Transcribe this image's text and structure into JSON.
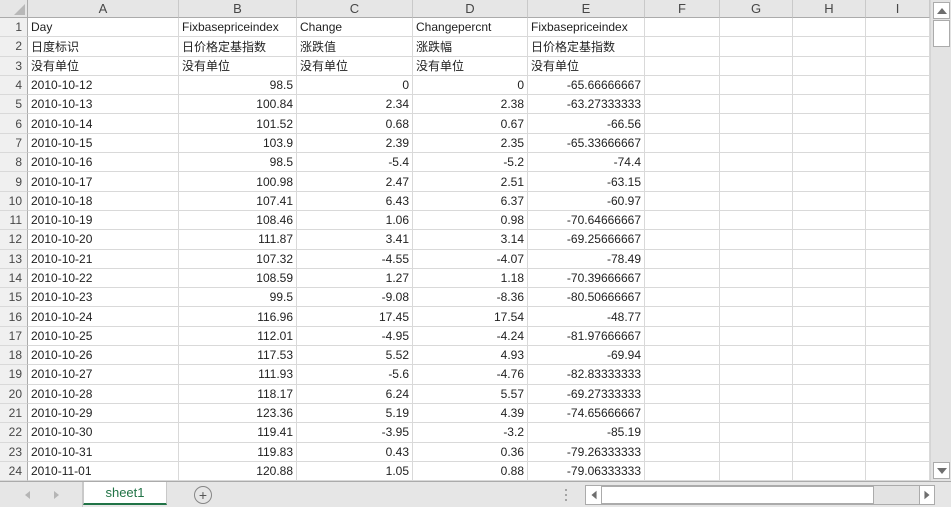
{
  "grid": {
    "column_letters": [
      "A",
      "B",
      "C",
      "D",
      "E",
      "F",
      "G",
      "H",
      "I"
    ],
    "rows": [
      {
        "n": "1",
        "cells": [
          "Day",
          "Fixbasepriceindex",
          "Change",
          "Changepercnt",
          "Fixbasepriceindex",
          "",
          "",
          "",
          ""
        ]
      },
      {
        "n": "2",
        "cells": [
          "日度标识",
          "日价格定基指数",
          "涨跌值",
          "涨跌幅",
          "日价格定基指数",
          "",
          "",
          "",
          ""
        ]
      },
      {
        "n": "3",
        "cells": [
          "没有单位",
          "没有单位",
          "没有单位",
          "没有单位",
          "没有单位",
          "",
          "",
          "",
          ""
        ]
      },
      {
        "n": "4",
        "cells": [
          "2010-10-12",
          "98.5",
          "0",
          "0",
          "-65.66666667",
          "",
          "",
          "",
          ""
        ]
      },
      {
        "n": "5",
        "cells": [
          "2010-10-13",
          "100.84",
          "2.34",
          "2.38",
          "-63.27333333",
          "",
          "",
          "",
          ""
        ]
      },
      {
        "n": "6",
        "cells": [
          "2010-10-14",
          "101.52",
          "0.68",
          "0.67",
          "-66.56",
          "",
          "",
          "",
          ""
        ]
      },
      {
        "n": "7",
        "cells": [
          "2010-10-15",
          "103.9",
          "2.39",
          "2.35",
          "-65.33666667",
          "",
          "",
          "",
          ""
        ]
      },
      {
        "n": "8",
        "cells": [
          "2010-10-16",
          "98.5",
          "-5.4",
          "-5.2",
          "-74.4",
          "",
          "",
          "",
          ""
        ]
      },
      {
        "n": "9",
        "cells": [
          "2010-10-17",
          "100.98",
          "2.47",
          "2.51",
          "-63.15",
          "",
          "",
          "",
          ""
        ]
      },
      {
        "n": "10",
        "cells": [
          "2010-10-18",
          "107.41",
          "6.43",
          "6.37",
          "-60.97",
          "",
          "",
          "",
          ""
        ]
      },
      {
        "n": "11",
        "cells": [
          "2010-10-19",
          "108.46",
          "1.06",
          "0.98",
          "-70.64666667",
          "",
          "",
          "",
          ""
        ]
      },
      {
        "n": "12",
        "cells": [
          "2010-10-20",
          "111.87",
          "3.41",
          "3.14",
          "-69.25666667",
          "",
          "",
          "",
          ""
        ]
      },
      {
        "n": "13",
        "cells": [
          "2010-10-21",
          "107.32",
          "-4.55",
          "-4.07",
          "-78.49",
          "",
          "",
          "",
          ""
        ]
      },
      {
        "n": "14",
        "cells": [
          "2010-10-22",
          "108.59",
          "1.27",
          "1.18",
          "-70.39666667",
          "",
          "",
          "",
          ""
        ]
      },
      {
        "n": "15",
        "cells": [
          "2010-10-23",
          "99.5",
          "-9.08",
          "-8.36",
          "-80.50666667",
          "",
          "",
          "",
          ""
        ]
      },
      {
        "n": "16",
        "cells": [
          "2010-10-24",
          "116.96",
          "17.45",
          "17.54",
          "-48.77",
          "",
          "",
          "",
          ""
        ]
      },
      {
        "n": "17",
        "cells": [
          "2010-10-25",
          "112.01",
          "-4.95",
          "-4.24",
          "-81.97666667",
          "",
          "",
          "",
          ""
        ]
      },
      {
        "n": "18",
        "cells": [
          "2010-10-26",
          "117.53",
          "5.52",
          "4.93",
          "-69.94",
          "",
          "",
          "",
          ""
        ]
      },
      {
        "n": "19",
        "cells": [
          "2010-10-27",
          "111.93",
          "-5.6",
          "-4.76",
          "-82.83333333",
          "",
          "",
          "",
          ""
        ]
      },
      {
        "n": "20",
        "cells": [
          "2010-10-28",
          "118.17",
          "6.24",
          "5.57",
          "-69.27333333",
          "",
          "",
          "",
          ""
        ]
      },
      {
        "n": "21",
        "cells": [
          "2010-10-29",
          "123.36",
          "5.19",
          "4.39",
          "-74.65666667",
          "",
          "",
          "",
          ""
        ]
      },
      {
        "n": "22",
        "cells": [
          "2010-10-30",
          "119.41",
          "-3.95",
          "-3.2",
          "-85.19",
          "",
          "",
          "",
          ""
        ]
      },
      {
        "n": "23",
        "cells": [
          "2010-10-31",
          "119.83",
          "0.43",
          "0.36",
          "-79.26333333",
          "",
          "",
          "",
          ""
        ]
      },
      {
        "n": "24",
        "cells": [
          "2010-11-01",
          "120.88",
          "1.05",
          "0.88",
          "-79.06333333",
          "",
          "",
          "",
          ""
        ]
      }
    ]
  },
  "sheet_bar": {
    "active_tab": "sheet1",
    "add_sheet_label": "+"
  },
  "icons": {
    "select_all": "corner-triangle",
    "scroll_up": "triangle-up",
    "scroll_down": "triangle-down",
    "scroll_left": "triangle-left",
    "scroll_right": "triangle-right",
    "tab_nav_left": "triangle-left",
    "tab_nav_right": "triangle-right",
    "add_sheet": "plus-circle",
    "tab_gripper": "vertical-dots"
  },
  "colors": {
    "accent_green": "#217346",
    "header_bg": "#E6E6E6",
    "gridline": "#D9D9D9",
    "header_border": "#ABABAB",
    "cell_text": "#1F1F1F",
    "header_text": "#474747"
  }
}
